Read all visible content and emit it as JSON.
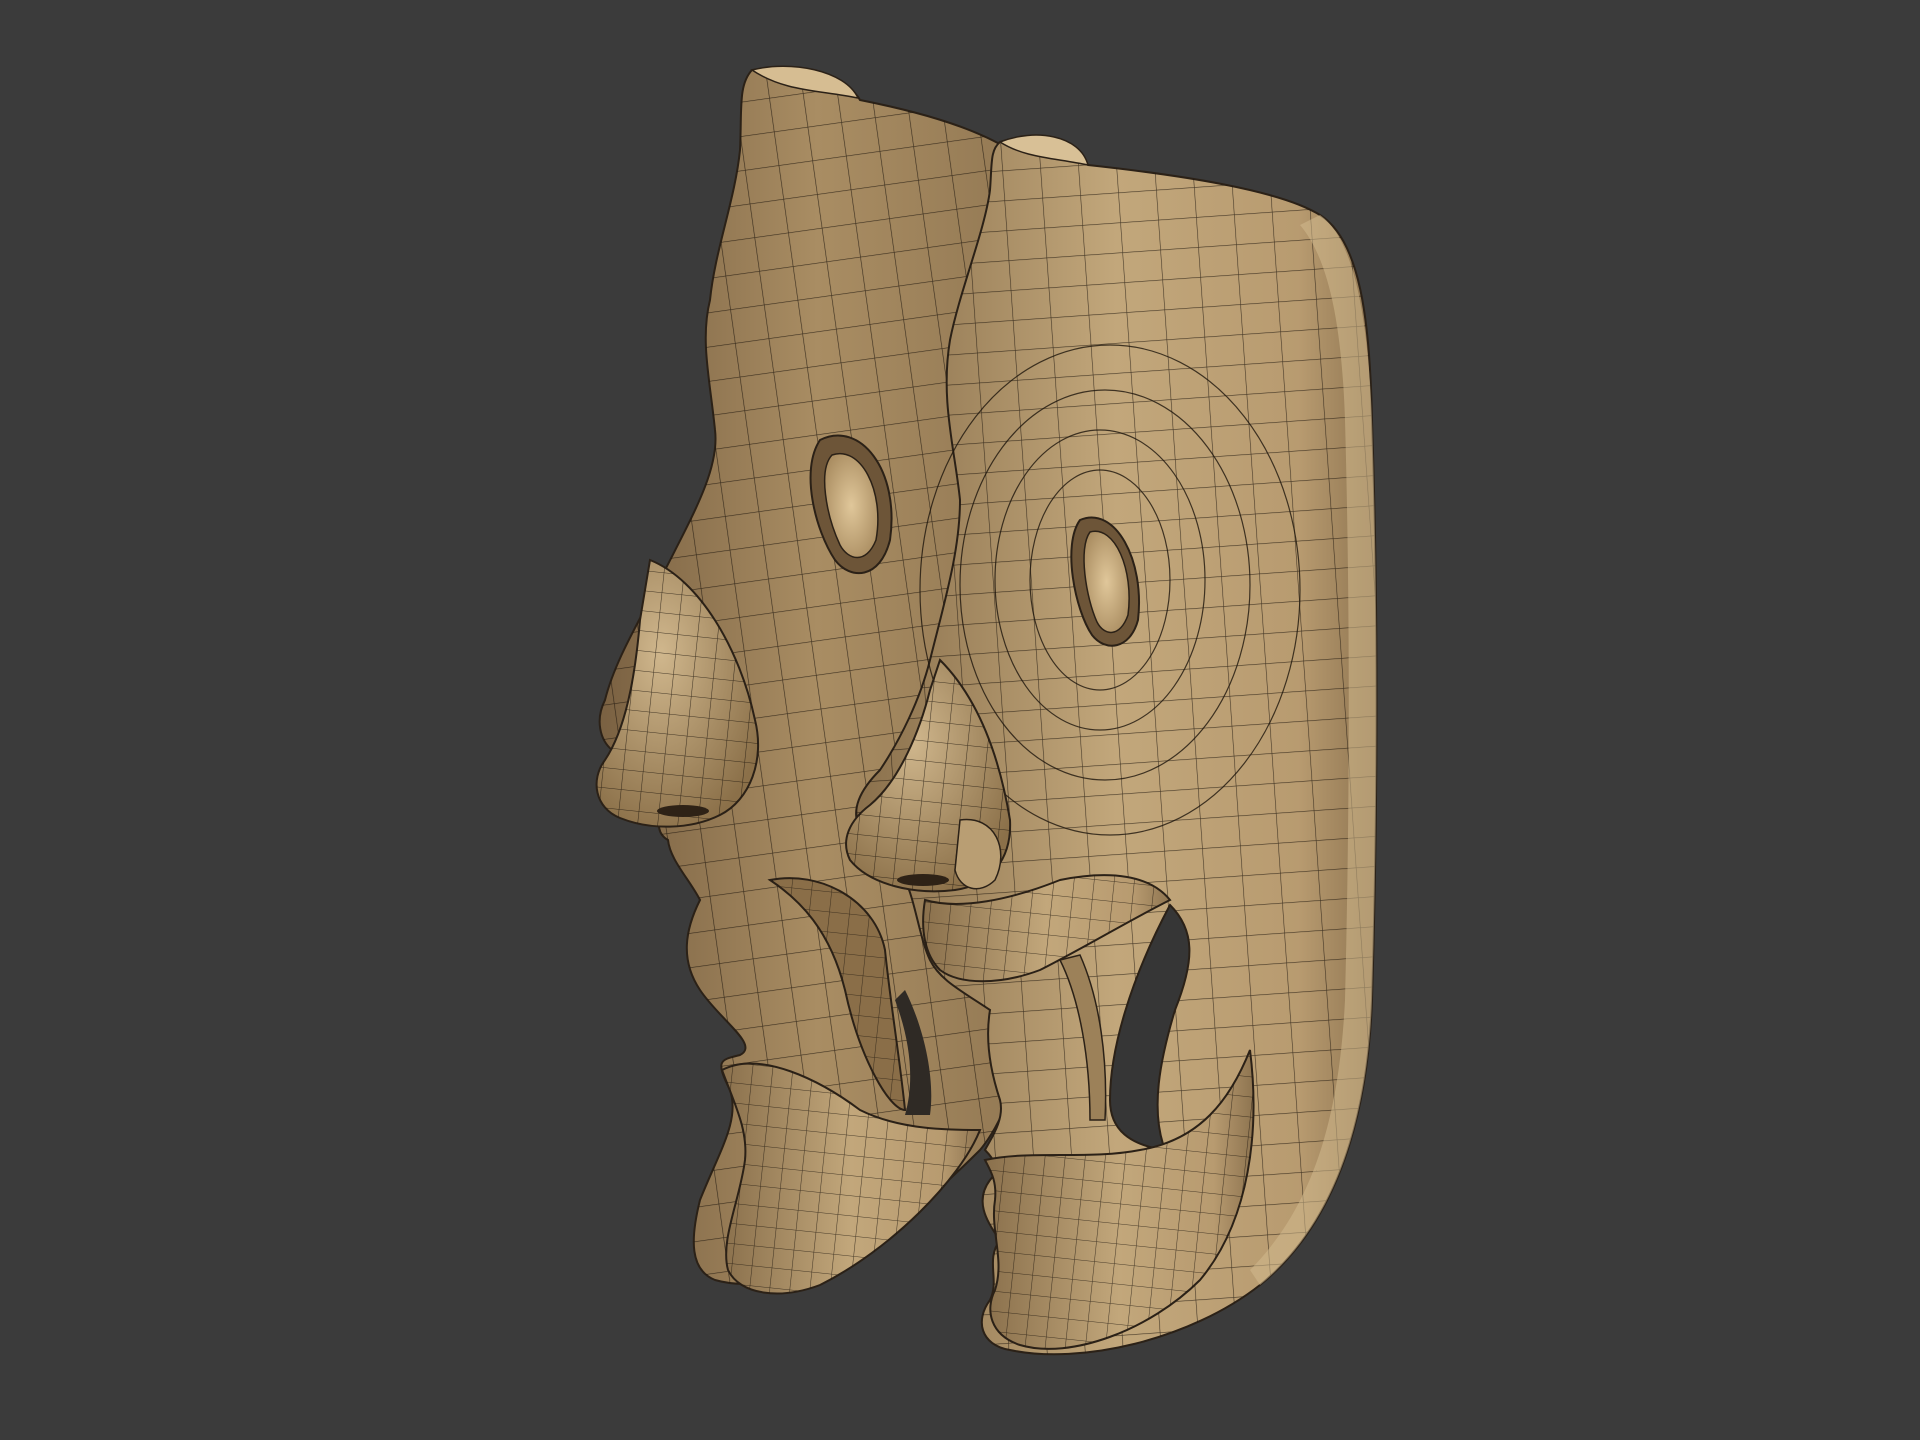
{
  "viewport": {
    "background": "#3b3b3b",
    "subject": "two-theatre-masks-wireframe",
    "surface_color": "#b89b72",
    "surface_light": "#cdb48a",
    "surface_shadow": "#6b5538",
    "wire_color": "#1e160d"
  }
}
